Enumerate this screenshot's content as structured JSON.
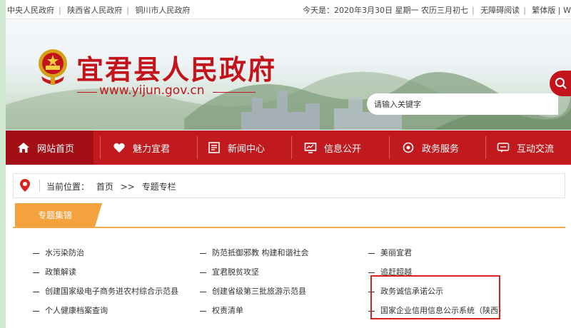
{
  "topbar": {
    "links": [
      "中央人民政府",
      "陕西省人民政府",
      "铜川市人民政府"
    ],
    "date_text": "今天是：2020年3月30日  星期一  农历三月初七",
    "accessibility": "无障碍阅读",
    "traditional": "繁体版",
    "extra": "|  W"
  },
  "header": {
    "title": "宜君县人民政府",
    "url": "www.yijun.gov.cn",
    "search_placeholder": "请输入关键字"
  },
  "nav": {
    "items": [
      {
        "label": "网站首页",
        "icon": "home-icon",
        "active": true
      },
      {
        "label": "魅力宜君",
        "icon": "heart-icon"
      },
      {
        "label": "新闻中心",
        "icon": "news-icon"
      },
      {
        "label": "信息公开",
        "icon": "monitor-icon"
      },
      {
        "label": "政务服务",
        "icon": "service-icon"
      },
      {
        "label": "互动交流",
        "icon": "chat-icon"
      }
    ]
  },
  "breadcrumb": {
    "prefix": "当前位置：",
    "home": "首页",
    "separator": ">>",
    "current": "专题专栏"
  },
  "section": {
    "tab_label": "专题集锦"
  },
  "topics": {
    "col1": [
      "水污染防治",
      "政策解读",
      "创建国家级电子商务进农村综合示范县",
      "个人健康档案查询"
    ],
    "col2": [
      "防范抵御邪教 构建和谐社会",
      "宜君脱贫攻坚",
      "创建省级第三批旅游示范县",
      "权责清单"
    ],
    "col3": [
      "美丽宜君",
      "追赶超越",
      "政务诚信承诺公示",
      "国家企业信用信息公示系统（陕西）"
    ]
  },
  "colors": {
    "brand_red": "#c0191e",
    "nav_active": "#a30f15",
    "tab_orange": "#f3a23e",
    "highlight": "#d9211e"
  }
}
